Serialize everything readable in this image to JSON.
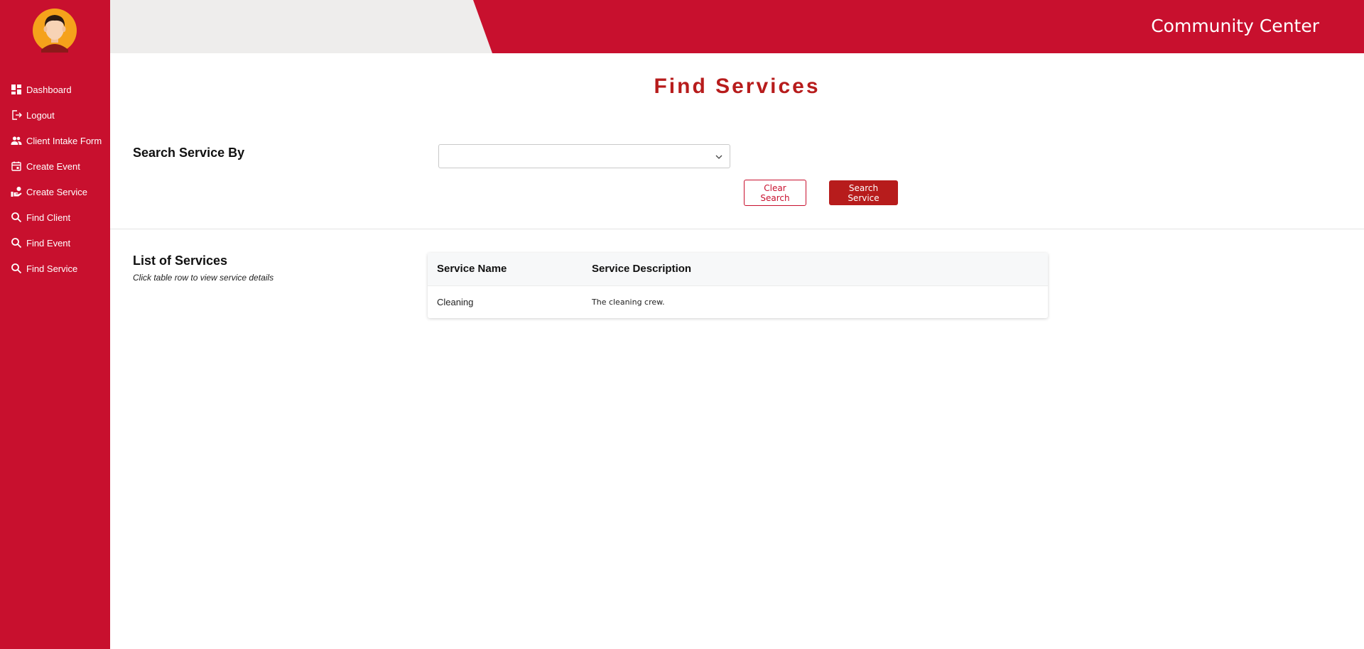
{
  "app": {
    "title": "Community Center"
  },
  "colors": {
    "brand": "#c8102e",
    "accent": "#b71c1c",
    "topbar_bg": "#eeedec"
  },
  "sidebar": {
    "avatar_icon": "user-avatar",
    "items": [
      {
        "label": "Dashboard",
        "icon": "dashboard-icon"
      },
      {
        "label": "Logout",
        "icon": "logout-icon"
      },
      {
        "label": "Client Intake Form",
        "icon": "people-icon"
      },
      {
        "label": "Create Event",
        "icon": "calendar-icon"
      },
      {
        "label": "Create Service",
        "icon": "service-hand-icon"
      },
      {
        "label": "Find Client",
        "icon": "search-icon"
      },
      {
        "label": "Find Event",
        "icon": "search-icon"
      },
      {
        "label": "Find Service",
        "icon": "search-icon"
      }
    ]
  },
  "main": {
    "title": "Find Services",
    "search": {
      "label": "Search Service By",
      "selected_value": "",
      "clear_label": "Clear Search",
      "submit_label": "Search Service"
    },
    "list": {
      "title": "List of Services",
      "hint": "Click table row to view service details",
      "columns": [
        "Service Name",
        "Service Description"
      ],
      "rows": [
        {
          "name": "Cleaning",
          "description": "The cleaning crew."
        }
      ]
    }
  }
}
